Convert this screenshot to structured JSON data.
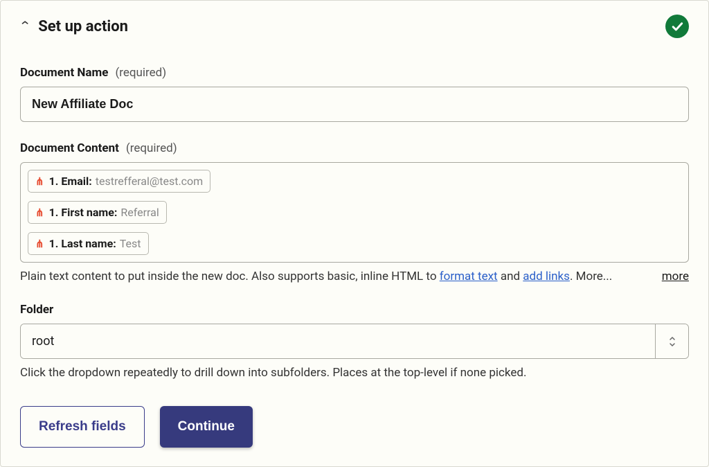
{
  "header": {
    "title": "Set up action"
  },
  "fields": {
    "document_name": {
      "label": "Document Name",
      "required_tag": "(required)",
      "value": "New Affiliate Doc"
    },
    "document_content": {
      "label": "Document Content",
      "required_tag": "(required)",
      "pills": [
        {
          "label": "1. Email:",
          "value": "testrefferal@test.com"
        },
        {
          "label": "1. First name:",
          "value": "Referral"
        },
        {
          "label": "1. Last name:",
          "value": "Test"
        }
      ],
      "help_prefix": "Plain text content to put inside the new doc. Also supports basic, inline HTML to ",
      "help_link1": "format text",
      "help_mid": " and ",
      "help_link2": "add links",
      "help_suffix": ". More...",
      "more_label": "more"
    },
    "folder": {
      "label": "Folder",
      "value": "root",
      "help": "Click the dropdown repeatedly to drill down into subfolders. Places at the top-level if none picked."
    }
  },
  "buttons": {
    "refresh": "Refresh fields",
    "continue": "Continue"
  }
}
